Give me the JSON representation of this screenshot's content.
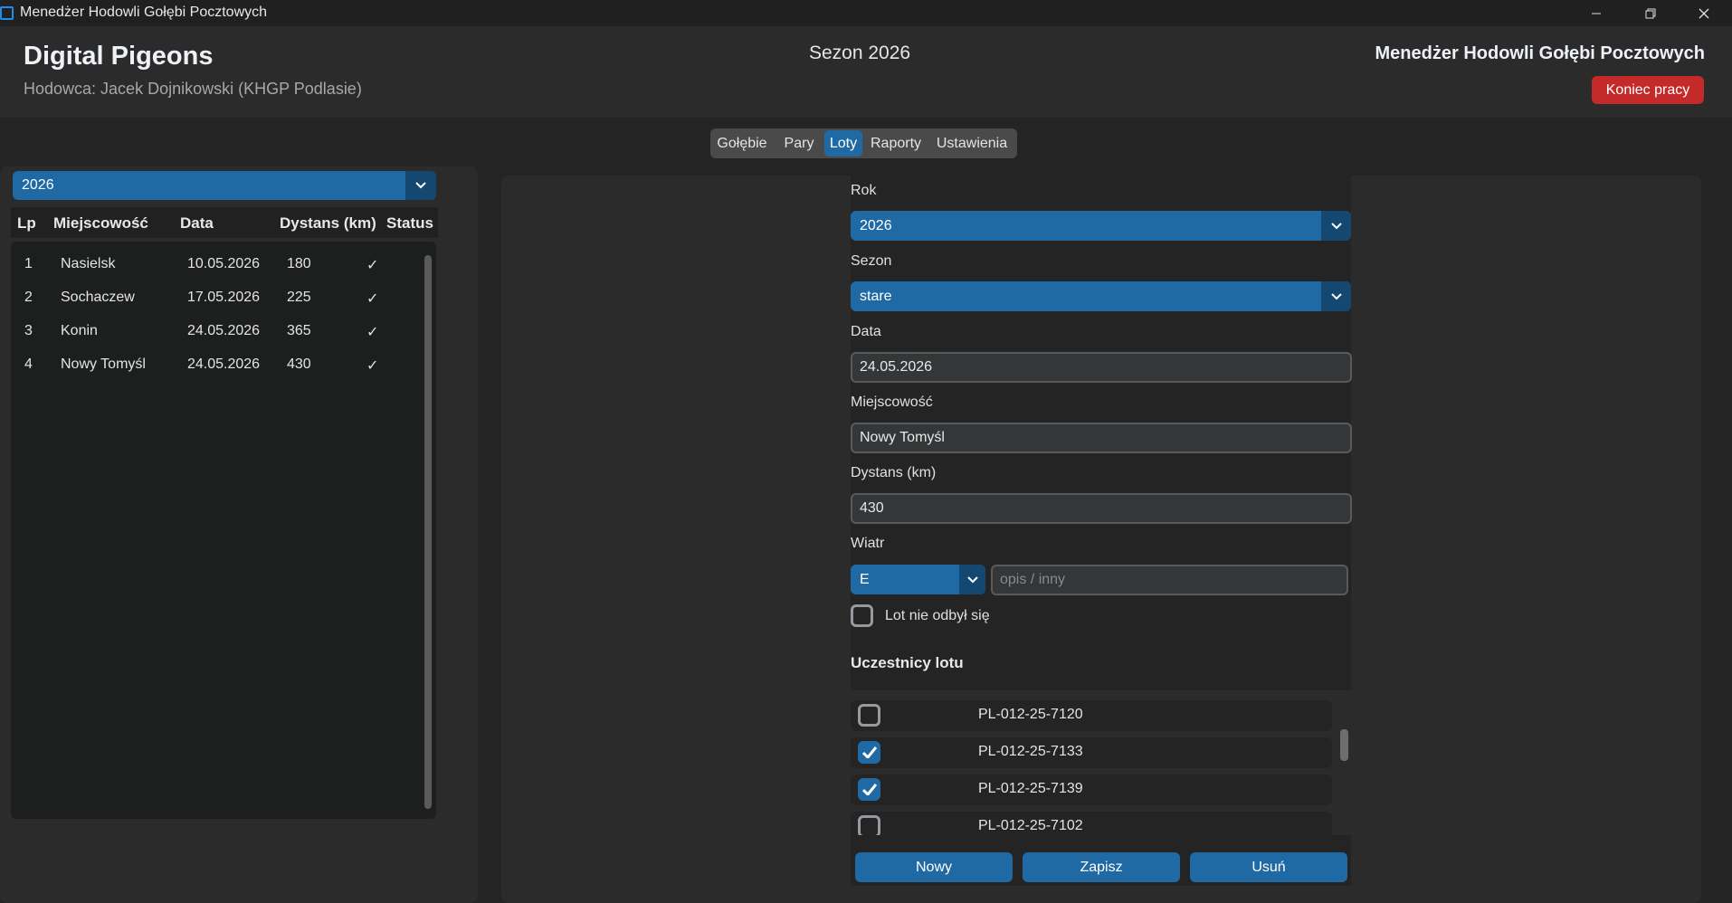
{
  "window": {
    "title": "Menedżer Hodowli Gołębi Pocztowych",
    "controls": [
      "minimize",
      "restore",
      "close"
    ]
  },
  "header": {
    "brand": "Digital Pigeons",
    "breeder": "Hodowca: Jacek Dojnikowski (KHGP Podlasie)",
    "season": "Sezon 2026",
    "app_name": "Menedżer Hodowli Gołębi Pocztowych",
    "logout_label": "Koniec pracy"
  },
  "tabs": [
    {
      "label": "Gołębie",
      "active": false
    },
    {
      "label": "Pary",
      "active": false
    },
    {
      "label": "Loty",
      "active": true
    },
    {
      "label": "Raporty",
      "active": false
    },
    {
      "label": "Ustawienia",
      "active": false
    }
  ],
  "flights_list": {
    "year_filter": "2026",
    "columns": [
      "Lp",
      "Miejscowość",
      "Data",
      "Dystans (km)",
      "Status"
    ],
    "rows": [
      {
        "lp": "1",
        "place": "Nasielsk",
        "date": "10.05.2026",
        "distance": "180",
        "status": "✓"
      },
      {
        "lp": "2",
        "place": "Sochaczew",
        "date": "17.05.2026",
        "distance": "225",
        "status": "✓"
      },
      {
        "lp": "3",
        "place": "Konin",
        "date": "24.05.2026",
        "distance": "365",
        "status": "✓"
      },
      {
        "lp": "4",
        "place": "Nowy Tomyśl",
        "date": "24.05.2026",
        "distance": "430",
        "status": "✓"
      }
    ]
  },
  "form": {
    "year_label": "Rok",
    "year_value": "2026",
    "season_label": "Sezon",
    "season_value": "stare",
    "date_label": "Data",
    "date_value": "24.05.2026",
    "place_label": "Miejscowość",
    "place_value": "Nowy Tomyśl",
    "distance_label": "Dystans (km)",
    "distance_value": "430",
    "wind_label": "Wiatr",
    "wind_value": "E",
    "wind_desc_placeholder": "opis / inny",
    "not_held_label": "Lot nie odbył się",
    "not_held_checked": false,
    "participants_title": "Uczestnicy lotu",
    "participants": [
      {
        "ring": "PL-012-25-7120",
        "checked": false
      },
      {
        "ring": "PL-012-25-7133",
        "checked": true
      },
      {
        "ring": "PL-012-25-7139",
        "checked": true
      },
      {
        "ring": "PL-012-25-7102",
        "checked": false
      }
    ]
  },
  "actions": {
    "new_label": "Nowy",
    "save_label": "Zapisz",
    "delete_label": "Usuń"
  },
  "colors": {
    "accent": "#1f6aa5",
    "danger": "#c42a2a",
    "background": "#242424",
    "panel": "#2b2b2b"
  }
}
